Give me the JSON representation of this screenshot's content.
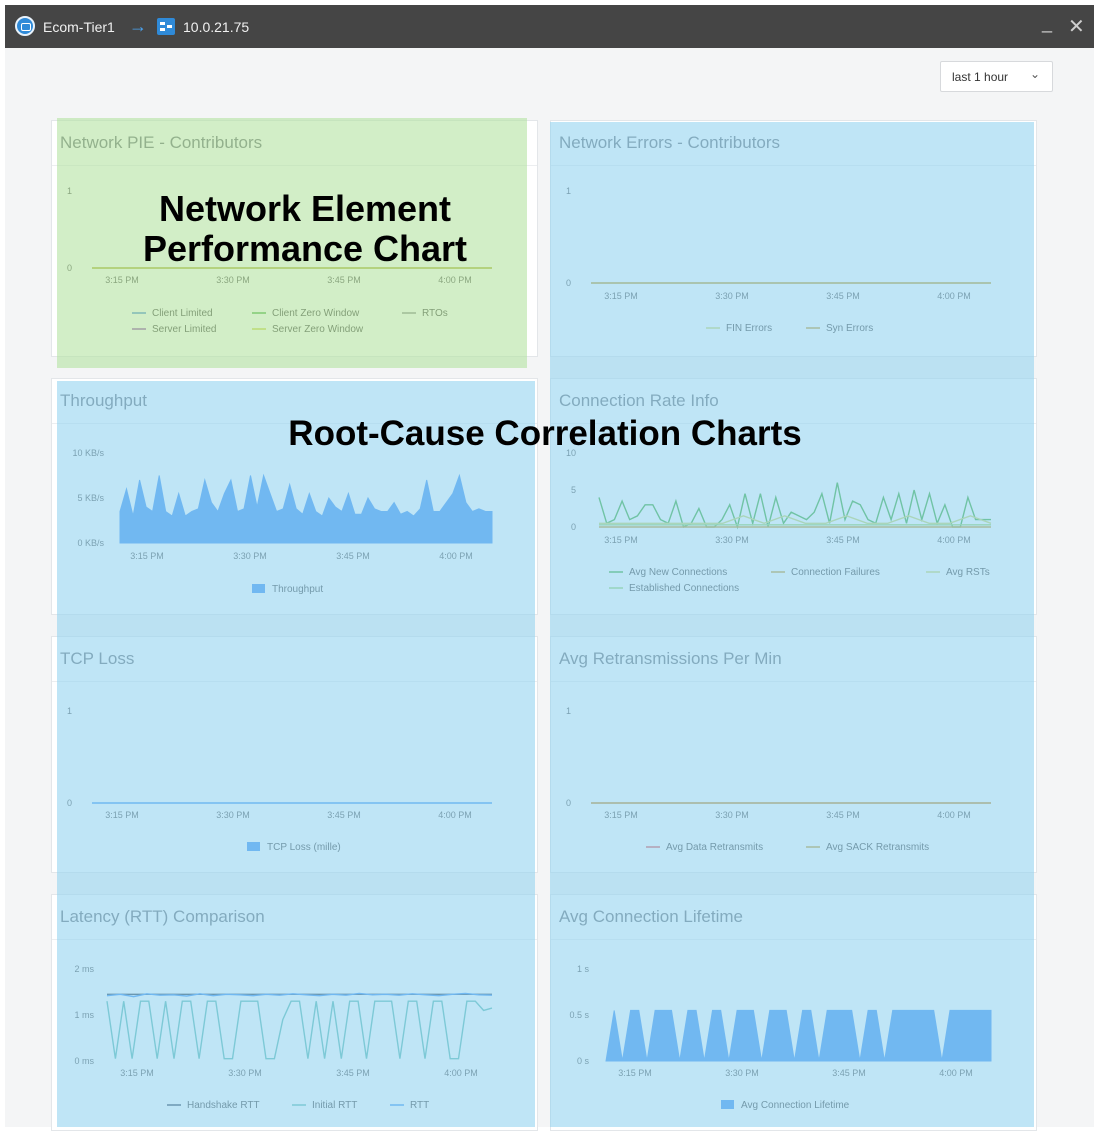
{
  "window": {
    "tier_label": "Ecom-Tier1",
    "host_label": "10.0.21.75",
    "icons": [
      "app-logo-icon",
      "arrow-right-icon",
      "host-network-icon",
      "minimize-icon",
      "close-icon"
    ]
  },
  "time_range": {
    "selected": "last 1 hour"
  },
  "overlays": {
    "network_line1": "Network Element",
    "network_line2": "Performance Chart",
    "root_cause": "Root-Cause Correlation Charts"
  },
  "colors": {
    "green_tint": "#b2e29e",
    "blue_tint": "#94d3f0",
    "accent_blue": "#3d8ff2"
  },
  "chart_data": [
    {
      "id": "pie",
      "title": "Network PIE - Contributors",
      "type": "line",
      "x_ticks": [
        "3:15 PM",
        "3:30 PM",
        "3:45 PM",
        "4:00 PM"
      ],
      "y_ticks": [
        "0",
        "1"
      ],
      "ylim": [
        0,
        1
      ],
      "legend_position": "bottom",
      "series": [
        {
          "name": "Client Limited",
          "color": "#3b82d6",
          "values": [
            0,
            0,
            0,
            0,
            0
          ]
        },
        {
          "name": "Client Zero Window",
          "color": "#3aaa35",
          "values": [
            0,
            0,
            0,
            0,
            0
          ]
        },
        {
          "name": "RTOs",
          "color": "#888888",
          "values": [
            0,
            0,
            0,
            0,
            0
          ]
        },
        {
          "name": "Server Limited",
          "color": "#8e44ad",
          "values": [
            0,
            0,
            0,
            0,
            0
          ]
        },
        {
          "name": "Server Zero Window",
          "color": "#c8d43a",
          "values": [
            0,
            0,
            0,
            0,
            0
          ]
        }
      ]
    },
    {
      "id": "errors",
      "title": "Network Errors - Contributors",
      "type": "line",
      "x_ticks": [
        "3:15 PM",
        "3:30 PM",
        "3:45 PM",
        "4:00 PM"
      ],
      "y_ticks": [
        "0",
        "1"
      ],
      "ylim": [
        0,
        1
      ],
      "legend_position": "bottom",
      "series": [
        {
          "name": "FIN Errors",
          "color": "#cbd66a",
          "values": [
            0,
            0,
            0,
            0,
            0
          ]
        },
        {
          "name": "Syn Errors",
          "color": "#c49a2c",
          "values": [
            0,
            0,
            0,
            0,
            0
          ]
        }
      ]
    },
    {
      "id": "throughput",
      "title": "Throughput",
      "type": "area",
      "x_ticks": [
        "3:15 PM",
        "3:30 PM",
        "3:45 PM",
        "4:00 PM"
      ],
      "y_ticks": [
        "0 KB/s",
        "5 KB/s",
        "10 KB/s"
      ],
      "ylim": [
        0,
        10
      ],
      "legend_position": "bottom",
      "series": [
        {
          "name": "Throughput",
          "color": "#3d8ff2",
          "values": [
            3.5,
            6.0,
            3.0,
            7.0,
            4.0,
            3.5,
            7.5,
            3.5,
            3.0,
            5.5,
            3.0,
            3.5,
            3.8,
            7.0,
            4.5,
            3.5,
            5.5,
            7.0,
            3.5,
            3.8,
            7.5,
            4.0,
            7.5,
            5.5,
            3.5,
            3.8,
            6.5,
            3.8,
            3.2,
            5.5,
            3.5,
            3.0,
            5.0,
            4.0,
            3.5,
            5.5,
            3.2,
            3.2,
            5.0,
            3.8,
            3.5,
            3.5,
            4.5,
            3.2,
            3.5,
            3.0,
            3.8,
            7.0,
            3.5,
            3.5,
            4.5,
            5.5,
            7.5,
            4.5,
            3.5,
            3.8,
            3.5,
            3.5
          ]
        }
      ]
    },
    {
      "id": "connrate",
      "title": "Connection Rate Info",
      "type": "line",
      "x_ticks": [
        "3:15 PM",
        "3:30 PM",
        "3:45 PM",
        "4:00 PM"
      ],
      "y_ticks": [
        "0",
        "5",
        "10"
      ],
      "ylim": [
        0,
        10
      ],
      "legend_position": "bottom",
      "series": [
        {
          "name": "Avg New Connections",
          "color": "#3aaa35",
          "values": [
            4,
            0.5,
            1,
            3.5,
            1,
            1.5,
            3,
            3,
            1,
            0.5,
            3.5,
            0,
            0.5,
            2.5,
            0,
            0,
            1,
            3,
            0,
            4.5,
            0.5,
            4.5,
            0,
            4,
            0.5,
            2,
            1.5,
            1,
            2,
            4.5,
            0.5,
            6,
            1,
            3.5,
            3,
            1,
            0.5,
            4,
            1,
            4.5,
            0.5,
            5,
            1,
            4.5,
            0.5,
            3,
            0,
            0,
            4,
            1,
            1,
            1
          ]
        },
        {
          "name": "Connection Failures",
          "color": "#c49a2c",
          "values": [
            0,
            0,
            0,
            0,
            0,
            0,
            0
          ]
        },
        {
          "name": "Avg RSTs",
          "color": "#cbd66a",
          "values": [
            0.5,
            0.5,
            0.5,
            0.5,
            0.5,
            0.5,
            0.5,
            1.5,
            0.5,
            1.5,
            0.5,
            0.5,
            1.5,
            0.5,
            0.5,
            1.5,
            0.5,
            0.5,
            1.5,
            0.5
          ]
        },
        {
          "name": "Established Connections",
          "color": "#9ad46b",
          "values": [
            0.3,
            0.3,
            0.3,
            0.3,
            0.3,
            0.3,
            0.3
          ]
        }
      ]
    },
    {
      "id": "tcploss",
      "title": "TCP Loss",
      "type": "line",
      "x_ticks": [
        "3:15 PM",
        "3:30 PM",
        "3:45 PM",
        "4:00 PM"
      ],
      "y_ticks": [
        "0",
        "1"
      ],
      "ylim": [
        0,
        1
      ],
      "legend_position": "bottom",
      "series": [
        {
          "name": "TCP Loss (mille)",
          "color": "#3d8ff2",
          "legend": "box",
          "values": [
            0,
            0,
            0,
            0,
            0
          ]
        }
      ]
    },
    {
      "id": "retrans",
      "title": "Avg Retransmissions Per Min",
      "type": "line",
      "x_ticks": [
        "3:15 PM",
        "3:30 PM",
        "3:45 PM",
        "4:00 PM"
      ],
      "y_ticks": [
        "0",
        "1"
      ],
      "ylim": [
        0,
        1
      ],
      "legend_position": "bottom",
      "series": [
        {
          "name": "Avg Data Retransmits",
          "color": "#e05252",
          "values": [
            0,
            0,
            0,
            0,
            0
          ]
        },
        {
          "name": "Avg SACK Retransmits",
          "color": "#c49a2c",
          "values": [
            0,
            0,
            0,
            0,
            0
          ]
        }
      ]
    },
    {
      "id": "latency",
      "title": "Latency (RTT) Comparison",
      "type": "line",
      "x_ticks": [
        "3:15 PM",
        "3:30 PM",
        "3:45 PM",
        "4:00 PM"
      ],
      "y_ticks": [
        "0 ms",
        "1 ms",
        "2 ms"
      ],
      "ylim": [
        0,
        2
      ],
      "legend_position": "bottom",
      "series": [
        {
          "name": "Handshake RTT",
          "color": "#2c3e50",
          "values": [
            1.45,
            1.45,
            1.45,
            1.45,
            1.45
          ]
        },
        {
          "name": "Initial RTT",
          "color": "#5bb8b0",
          "values": [
            1.3,
            0.05,
            1.3,
            0.05,
            1.3,
            1.3,
            0.05,
            1.3,
            0.05,
            1.3,
            1.3,
            0.05,
            1.3,
            1.3,
            0.05,
            0.05,
            1.3,
            1.3,
            1.3,
            0.05,
            0.05,
            0.9,
            1.3,
            1.3,
            0.05,
            1.3,
            0.05,
            1.3,
            0.05,
            1.3,
            1.3,
            0.05,
            1.3,
            1.3,
            1.3,
            0.05,
            1.3,
            1.3,
            0.05,
            1.3,
            1.3,
            0.05,
            0.05,
            1.3,
            1.3,
            1.1,
            1.15
          ]
        },
        {
          "name": "RTT",
          "color": "#3d8ff2",
          "values": [
            1.42,
            1.45,
            1.4,
            1.46,
            1.43,
            1.44,
            1.41,
            1.46,
            1.42,
            1.45,
            1.44,
            1.42,
            1.45,
            1.43,
            1.46,
            1.44,
            1.42,
            1.45,
            1.43,
            1.47,
            1.44,
            1.45,
            1.43,
            1.46,
            1.44,
            1.42,
            1.45,
            1.47,
            1.44,
            1.43
          ]
        }
      ]
    },
    {
      "id": "lifetime",
      "title": "Avg Connection Lifetime",
      "type": "area",
      "x_ticks": [
        "3:15 PM",
        "3:30 PM",
        "3:45 PM",
        "4:00 PM"
      ],
      "y_ticks": [
        "0 s",
        "0.5 s",
        "1 s"
      ],
      "ylim": [
        0,
        1
      ],
      "legend_position": "bottom",
      "series": [
        {
          "name": "Avg Connection Lifetime",
          "color": "#3d8ff2",
          "values": [
            0,
            0.55,
            0,
            0.55,
            0.55,
            0,
            0.55,
            0.55,
            0.55,
            0,
            0.55,
            0.55,
            0,
            0.55,
            0.55,
            0,
            0.55,
            0.55,
            0.55,
            0,
            0.55,
            0.55,
            0.55,
            0,
            0.55,
            0.55,
            0,
            0.55,
            0.55,
            0.55,
            0.55,
            0,
            0.55,
            0.55,
            0,
            0.55,
            0.55,
            0.55,
            0.55,
            0.55,
            0.55,
            0,
            0.55,
            0.55,
            0.55,
            0.55,
            0.55,
            0.55
          ]
        }
      ]
    }
  ]
}
